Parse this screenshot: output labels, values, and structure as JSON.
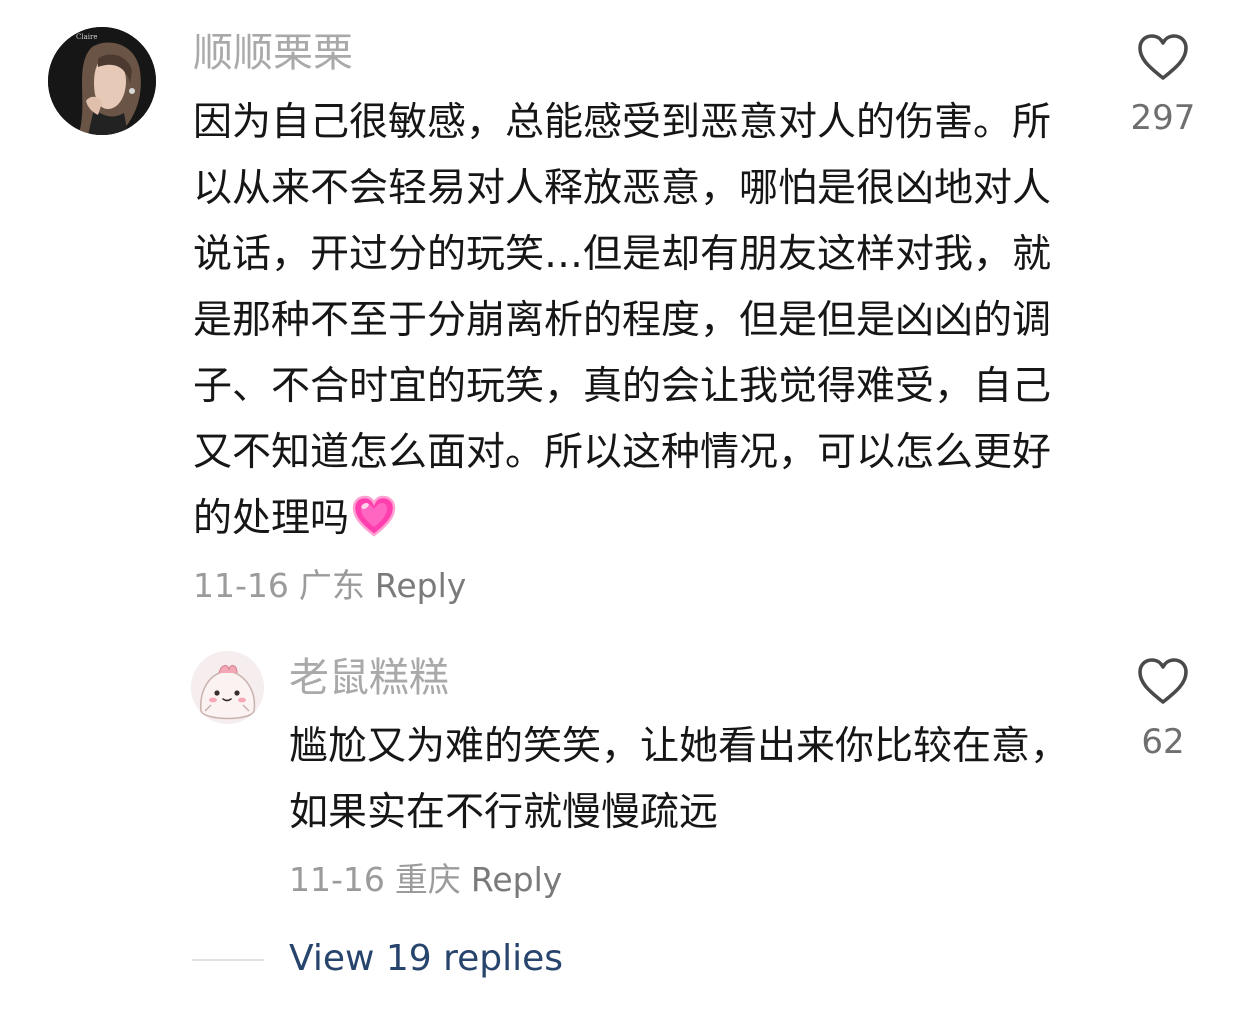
{
  "comment": {
    "username": "顺顺栗栗",
    "text": "因为自己很敏感，总能感受到恶意对人的伤害。所以从来不会轻易对人释放恶意，哪怕是很凶地对人说话，开过分的玩笑…但是却有朋友这样对我，就是那种不至于分崩离析的程度，但是但是凶凶的调子、不合时宜的玩笑，真的会让我觉得难受，自己又不知道怎么面对。所以这种情况，可以怎么更好的处理吗",
    "emoji": "pink-heart-emoji",
    "date": "11-16",
    "location": "广东",
    "reply_label": "Reply",
    "like_count": "297",
    "like_icon": "heart-outline-icon",
    "avatar_lettering": "Claire"
  },
  "reply": {
    "username": "老鼠糕糕",
    "text": "尴尬又为难的笑笑，让她看出来你比较在意，如果实在不行就慢慢疏远",
    "date": "11-16",
    "location": "重庆",
    "reply_label": "Reply",
    "like_count": "62",
    "like_icon": "heart-outline-icon"
  },
  "view_replies": {
    "label": "View 19 replies"
  },
  "colors": {
    "username": "#a9a9a9",
    "body_text": "#161616",
    "meta_text": "#9b9b9b",
    "view_replies": "#27446c",
    "emoji_pink": "#ff3fae"
  }
}
